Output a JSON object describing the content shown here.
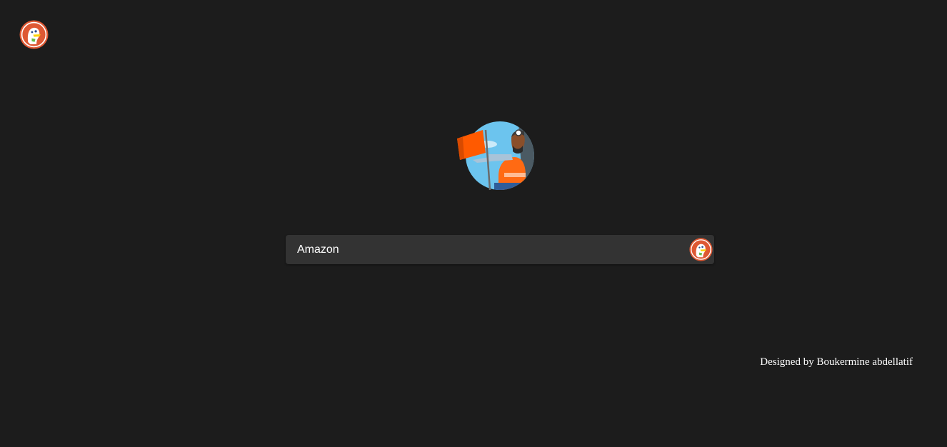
{
  "header": {
    "logo_icon": "duckduckgo-logo-icon"
  },
  "hero": {
    "illustration": "explorer-with-flag-illustration"
  },
  "search": {
    "value": "Amazon",
    "button_icon": "duckduckgo-logo-icon"
  },
  "footer": {
    "credit": "Designed by Boukermine abdellatif"
  },
  "colors": {
    "background": "#1c1c1c",
    "search_box": "#333333",
    "brand": "#de5833",
    "text": "#ffffff"
  }
}
